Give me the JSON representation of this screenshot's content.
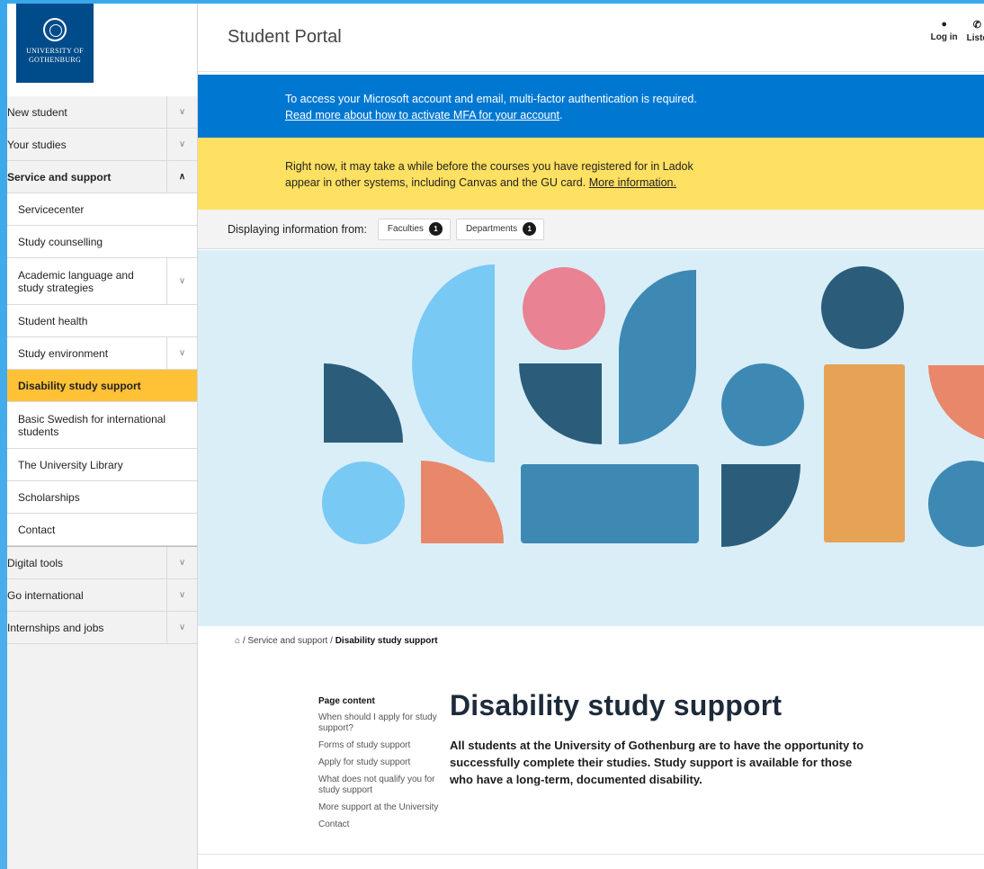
{
  "logo": {
    "line1": "UNIVERSITY OF",
    "line2": "GOTHENBURG"
  },
  "sidebar": {
    "top_items": [
      {
        "label": "New student"
      },
      {
        "label": "Your studies"
      },
      {
        "label": "Service and support"
      }
    ],
    "sub_items": [
      {
        "label": "Servicecenter"
      },
      {
        "label": "Study counselling"
      },
      {
        "label": "Academic language and study strategies"
      },
      {
        "label": "Student health"
      },
      {
        "label": "Study environment"
      },
      {
        "label": "Disability study support"
      },
      {
        "label": "Basic Swedish for international students"
      },
      {
        "label": "The University Library"
      },
      {
        "label": "Scholarships"
      },
      {
        "label": "Contact"
      }
    ],
    "bottom_items": [
      {
        "label": "Digital tools"
      },
      {
        "label": "Go international"
      },
      {
        "label": "Internships and jobs"
      }
    ]
  },
  "header": {
    "title": "Student Portal",
    "login_label": "Log in",
    "listen_label": "Liste"
  },
  "banners": {
    "mfa_text": "To access your Microsoft account and email, multi-factor authentication is required.",
    "mfa_link": "Read more about how to activate MFA for your account",
    "ladok_text_1": "Right now, it may take a while before the courses you have registered for in Ladok",
    "ladok_text_2": "appear in other systems, including Canvas and the GU card.",
    "ladok_link": "More information."
  },
  "filter": {
    "label": "Displaying information from:",
    "chips": [
      {
        "label": "Faculties",
        "count": "1"
      },
      {
        "label": "Departments",
        "count": "1"
      }
    ]
  },
  "breadcrumb": {
    "home_icon": "home-icon",
    "level1": "Service and support",
    "current": "Disability study support",
    "separator": "/"
  },
  "toc": {
    "title": "Page content",
    "items": [
      "When should I apply for study support?",
      "Forms of study support",
      "Apply for study support",
      "What does not qualify you for study support",
      "More support at the University",
      "Contact"
    ]
  },
  "article": {
    "title": "Disability study support",
    "lead": "All students at the University of Gothenburg are to have the opportunity to successfully complete their studies. Study support is available for those who have a long-term, documented disability."
  },
  "colors": {
    "brand_blue": "#004b89",
    "mfa_blue": "#0078d2",
    "notice_yellow": "#fee062",
    "active_yellow": "#ffc236",
    "hero_bg": "#daeef8"
  }
}
